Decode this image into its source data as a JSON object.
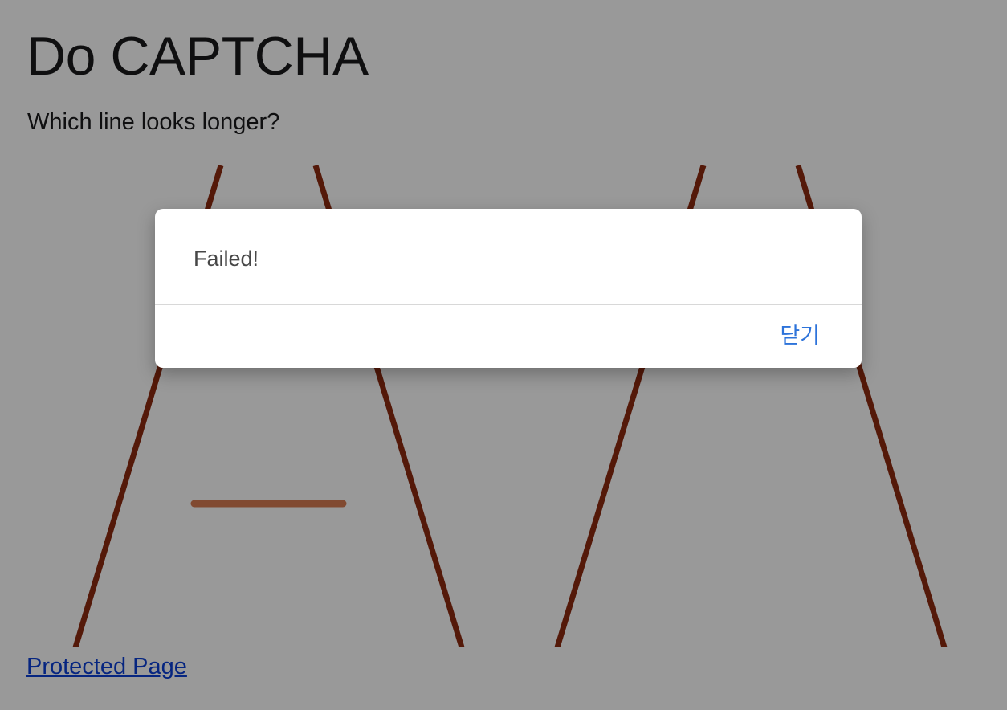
{
  "page": {
    "title": "Do CAPTCHA",
    "question": "Which line looks longer?",
    "link_label": "Protected Page"
  },
  "captcha": {
    "illusion": "ponzo",
    "rail_color": "#8c2a10",
    "segment_color": "#d87c52"
  },
  "dialog": {
    "message": "Failed!",
    "close_label": "닫기"
  }
}
